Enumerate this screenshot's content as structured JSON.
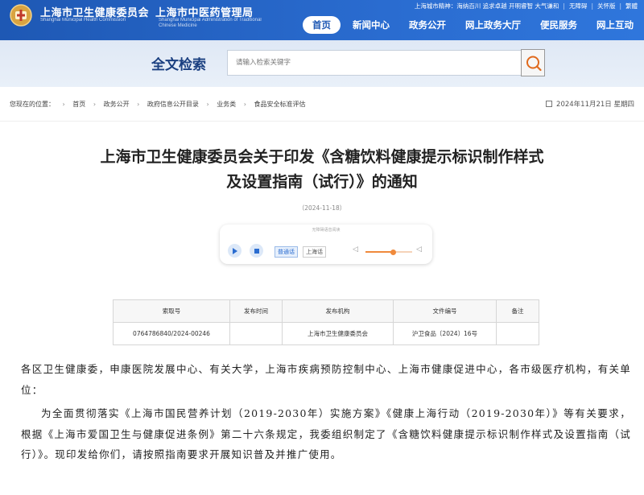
{
  "header": {
    "site_name_cn": "上海市卫生健康委员会",
    "site_name_cn_2": "上海市中医药管理局",
    "site_name_en": "Shanghai Municipal Health Commission",
    "site_name_en_2": "Shanghai Municipal Administration of Traditional Chinese Medicine",
    "top_links": {
      "spirit": "上海城市精神：海纳百川 追求卓越 开明睿智 大气谦和",
      "accessibility": "无障碍",
      "elderly": "关怀版",
      "traditional": "繁體"
    },
    "nav": [
      "首页",
      "新闻中心",
      "政务公开",
      "网上政务大厅",
      "便民服务",
      "网上互动"
    ],
    "active_nav": "首页"
  },
  "search": {
    "title": "全文检索",
    "placeholder": "请输入检索关键字",
    "button_icon": "search-icon"
  },
  "breadcrumb": {
    "label": "您现在的位置：",
    "items": [
      "首页",
      "政务公开",
      "政府信息公开目录",
      "业务类",
      "食品安全标准评估"
    ],
    "date": "2024年11月21日 星期四"
  },
  "article": {
    "title_line1": "上海市卫生健康委员会关于印发《含糖饮料健康提示标识制作样式",
    "title_line2": "及设置指南（试行）》的通知",
    "date": "（2024-11-18）"
  },
  "player": {
    "title": "无障碍语音阅读",
    "mandarin": "普通话",
    "shanghainese": "上海话",
    "volume": 0.6
  },
  "info_table": {
    "headers": [
      "索取号",
      "发布时间",
      "发布机构",
      "文件编号",
      "备注"
    ],
    "row": [
      "0764786840/2024-00246",
      "",
      "上海市卫生健康委员会",
      "沪卫食品〔2024〕16号",
      ""
    ]
  },
  "body": {
    "para1": "各区卫生健康委，申康医院发展中心、有关大学，上海市疾病预防控制中心、上海市健康促进中心，各市级医疗机构，有关单位：",
    "para2": "为全面贯彻落实《上海市国民营养计划（2019-2030年）实施方案》《健康上海行动（2019-2030年）》等有关要求，根据《上海市爱国卫生与健康促进条例》第二十六条规定，我委组织制定了《含糖饮料健康提示标识制作样式及设置指南（试行）》。现印发给你们，请按照指南要求开展知识普及并推广使用。"
  }
}
